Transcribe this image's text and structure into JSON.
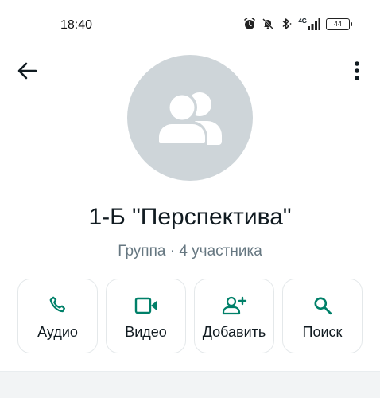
{
  "status_bar": {
    "time": "18:40",
    "network": "4G",
    "battery": "44",
    "icons": [
      "alarm-icon",
      "silent-bell-icon",
      "bluetooth-icon",
      "signal-icon",
      "battery-icon"
    ]
  },
  "header": {
    "back_icon": "arrow-left-icon",
    "menu_icon": "more-vertical-icon"
  },
  "profile": {
    "avatar_icon": "group-icon",
    "title": "1-Б \"Перспектива\"",
    "subtitle": "Группа · 4 участника"
  },
  "actions": [
    {
      "label": "Аудио",
      "icon": "phone-icon"
    },
    {
      "label": "Видео",
      "icon": "video-icon"
    },
    {
      "label": "Добавить",
      "icon": "add-person-icon"
    },
    {
      "label": "Поиск",
      "icon": "search-icon"
    }
  ],
  "colors": {
    "accent": "#008069",
    "avatar_bg": "#ced5d9",
    "text_primary": "#111b21",
    "text_secondary": "#667781"
  }
}
